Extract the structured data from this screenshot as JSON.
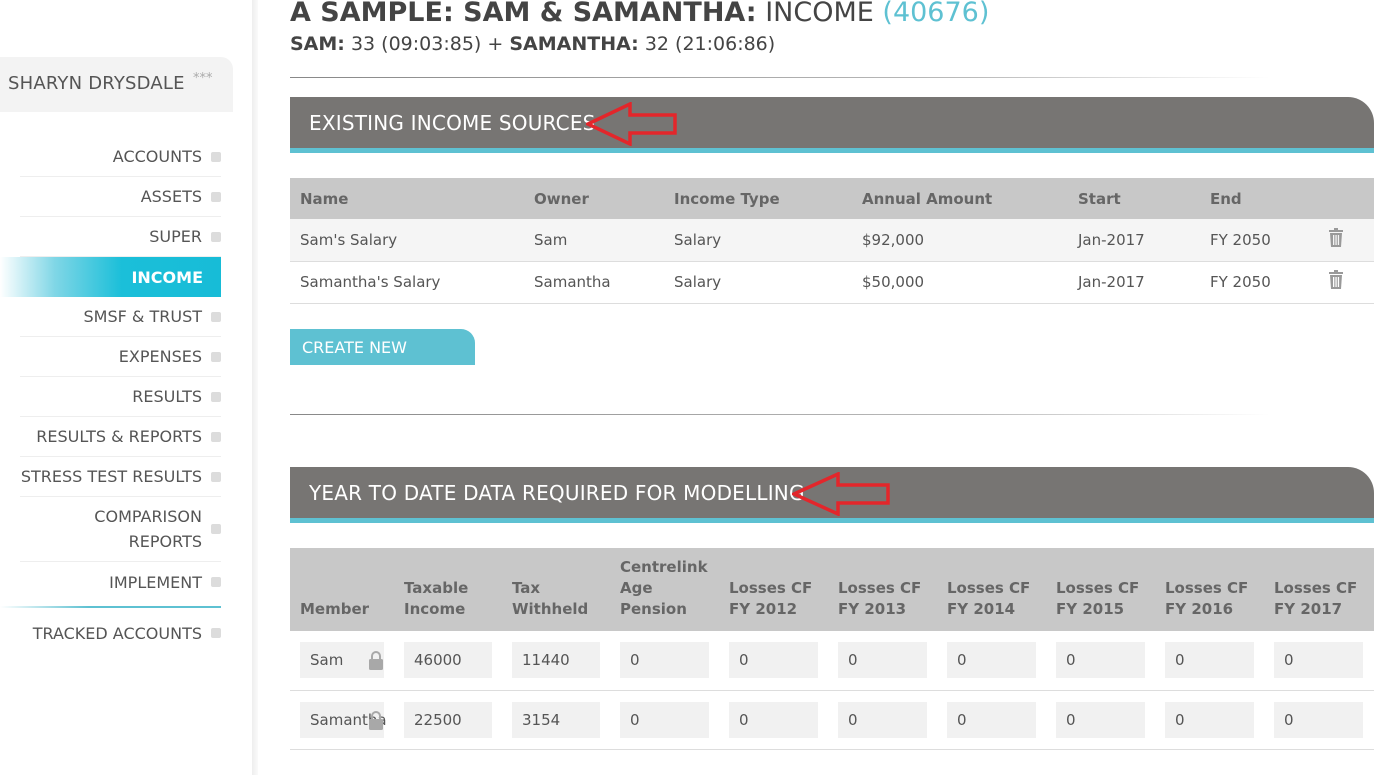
{
  "header": {
    "title_bold": "A SAMPLE: SAM & SAMANTHA:",
    "title_rest": "INCOME",
    "title_id": "(40676)",
    "sub_sam_label": "SAM:",
    "sub_sam_value": "33 (09:03:85) +",
    "sub_samantha_label": "SAMANTHA:",
    "sub_samantha_value": "32 (21:06:86)"
  },
  "sidebar": {
    "user_name": "SHARYN DRYSDALE",
    "user_stars": "***",
    "items": [
      {
        "label": "ACCOUNTS"
      },
      {
        "label": "ASSETS"
      },
      {
        "label": "SUPER"
      },
      {
        "label": "INCOME",
        "active": true
      },
      {
        "label": "SMSF & TRUST"
      },
      {
        "label": "EXPENSES"
      },
      {
        "label": "RESULTS"
      },
      {
        "label": "RESULTS & REPORTS"
      },
      {
        "label": "STRESS TEST RESULTS"
      },
      {
        "label_line1": "COMPARISON",
        "label_line2": "REPORTS"
      },
      {
        "label": "IMPLEMENT"
      },
      {
        "label": "TRACKED ACCOUNTS"
      }
    ]
  },
  "income_section": {
    "title": "EXISTING INCOME SOURCES",
    "columns": [
      "Name",
      "Owner",
      "Income Type",
      "Annual Amount",
      "Start",
      "End"
    ],
    "rows": [
      {
        "name": "Sam's Salary",
        "owner": "Sam",
        "type": "Salary",
        "amount": "$92,000",
        "start": "Jan-2017",
        "end": "FY 2050"
      },
      {
        "name": "Samantha's Salary",
        "owner": "Samantha",
        "type": "Salary",
        "amount": "$50,000",
        "start": "Jan-2017",
        "end": "FY 2050"
      }
    ],
    "create_button": "CREATE NEW INCOME"
  },
  "ytd_section": {
    "title": "YEAR TO DATE DATA REQUIRED FOR MODELLING",
    "columns": [
      {
        "l1": "Member"
      },
      {
        "l1": "Taxable",
        "l2": "Income"
      },
      {
        "l1": "Tax",
        "l2": "Withheld"
      },
      {
        "l1": "Centrelink",
        "l2": "Age",
        "l3": "Pension"
      },
      {
        "l1": "Losses CF",
        "l2": "FY 2012"
      },
      {
        "l1": "Losses CF",
        "l2": "FY 2013"
      },
      {
        "l1": "Losses CF",
        "l2": "FY 2014"
      },
      {
        "l1": "Losses CF",
        "l2": "FY 2015"
      },
      {
        "l1": "Losses CF",
        "l2": "FY 2016"
      },
      {
        "l1": "Losses CF",
        "l2": "FY 2017"
      }
    ],
    "rows": [
      {
        "member": "Sam",
        "taxable": "46000",
        "withheld": "11440",
        "pension": "0",
        "l2012": "0",
        "l2013": "0",
        "l2014": "0",
        "l2015": "0",
        "l2016": "0",
        "l2017": "0"
      },
      {
        "member": "Samantha",
        "taxable": "22500",
        "withheld": "3154",
        "pension": "0",
        "l2012": "0",
        "l2013": "0",
        "l2014": "0",
        "l2015": "0",
        "l2016": "0",
        "l2017": "0"
      }
    ]
  },
  "colors": {
    "accent": "#5ec1d2",
    "active_nav": "#17bcd7",
    "section_header": "#777573",
    "annotation_arrow": "#e3262b"
  }
}
